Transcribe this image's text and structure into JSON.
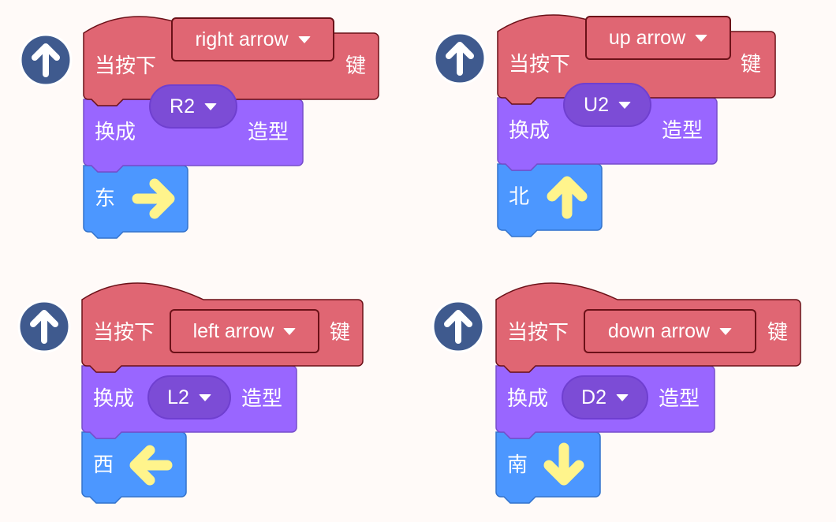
{
  "colors": {
    "event": "#e06673",
    "event_border": "#6b1118",
    "looks": "#9966ff",
    "looks_border": "#774dcb",
    "motion": "#4c97ff",
    "motion_border": "#3373cc",
    "arrow_yellow": "#fff48c",
    "icon_navy": "#3f5a8e"
  },
  "scripts": [
    {
      "hat_icon": "up-arrow-circle-icon",
      "when_pressed_text": "当按下",
      "key_value": "right arrow",
      "key_suffix": "键",
      "switch_text": "换成",
      "costume_value": "R2",
      "costume_suffix": "造型",
      "direction_text": "东",
      "direction_icon": "right-arrow-icon"
    },
    {
      "hat_icon": "up-arrow-circle-icon",
      "when_pressed_text": "当按下",
      "key_value": "up arrow",
      "key_suffix": "键",
      "switch_text": "换成",
      "costume_value": "U2",
      "costume_suffix": "造型",
      "direction_text": "北",
      "direction_icon": "up-arrow-icon"
    },
    {
      "hat_icon": "up-arrow-circle-icon",
      "when_pressed_text": "当按下",
      "key_value": "left arrow",
      "key_suffix": "键",
      "switch_text": "换成",
      "costume_value": "L2",
      "costume_suffix": "造型",
      "direction_text": "西",
      "direction_icon": "left-arrow-icon"
    },
    {
      "hat_icon": "up-arrow-circle-icon",
      "when_pressed_text": "当按下",
      "key_value": "down arrow",
      "key_suffix": "键",
      "switch_text": "换成",
      "costume_value": "D2",
      "costume_suffix": "造型",
      "direction_text": "南",
      "direction_icon": "down-arrow-icon"
    }
  ]
}
